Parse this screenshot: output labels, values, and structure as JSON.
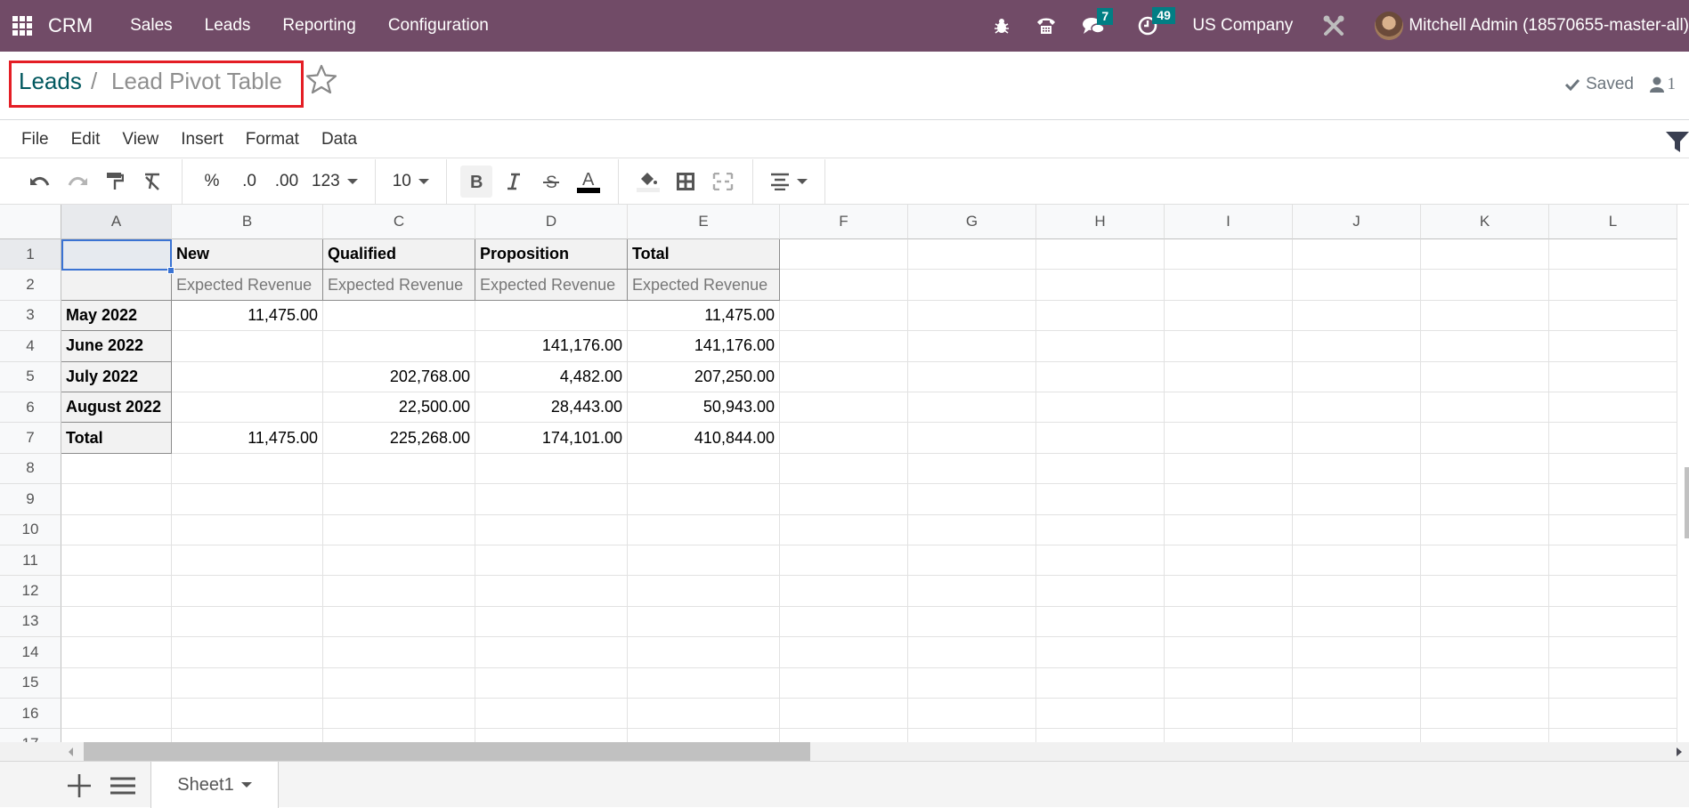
{
  "navbar": {
    "app_name": "CRM",
    "menus": [
      "Sales",
      "Leads",
      "Reporting",
      "Configuration"
    ],
    "icons": [
      "bug-icon",
      "phone-icon",
      "chat-icon",
      "clock-icon"
    ],
    "messages_badge": "7",
    "activities_badge": "49",
    "company": "US Company",
    "user": "Mitchell Admin (18570655-master-all)",
    "brand_color": "#714b67",
    "badge_color": "#017e84"
  },
  "breadcrumb": {
    "parent": "Leads",
    "separator": "/",
    "current": "Lead Pivot Table"
  },
  "status": {
    "saved_label": "Saved",
    "users_count": "1"
  },
  "menubar": {
    "items": [
      "File",
      "Edit",
      "View",
      "Insert",
      "Format",
      "Data"
    ]
  },
  "toolbar": {
    "percent": "%",
    "decrease_decimal": ".0",
    "increase_decimal": ".00",
    "number_format": "123",
    "font_size": "10"
  },
  "sheet": {
    "columns": [
      "A",
      "B",
      "C",
      "D",
      "E",
      "F",
      "G",
      "H",
      "I",
      "J",
      "K",
      "L"
    ],
    "rows": [
      "1",
      "2",
      "3",
      "4",
      "5",
      "6",
      "7",
      "8",
      "9",
      "10",
      "11",
      "12",
      "13",
      "14",
      "15",
      "16",
      "17"
    ],
    "selected_cell": "A1",
    "pivot": {
      "col_headers": [
        "New",
        "Qualified",
        "Proposition",
        "Total"
      ],
      "measure": "Expected Revenue",
      "row_labels": [
        "May 2022",
        "June 2022",
        "July 2022",
        "August 2022",
        "Total"
      ],
      "values": [
        [
          "11,475.00",
          "",
          "",
          "11,475.00"
        ],
        [
          "",
          "",
          "141,176.00",
          "141,176.00"
        ],
        [
          "",
          "202,768.00",
          "4,482.00",
          "207,250.00"
        ],
        [
          "",
          "22,500.00",
          "28,443.00",
          "50,943.00"
        ],
        [
          "11,475.00",
          "225,268.00",
          "174,101.00",
          "410,844.00"
        ]
      ]
    }
  },
  "sheets": {
    "tabs": [
      "Sheet1"
    ]
  }
}
